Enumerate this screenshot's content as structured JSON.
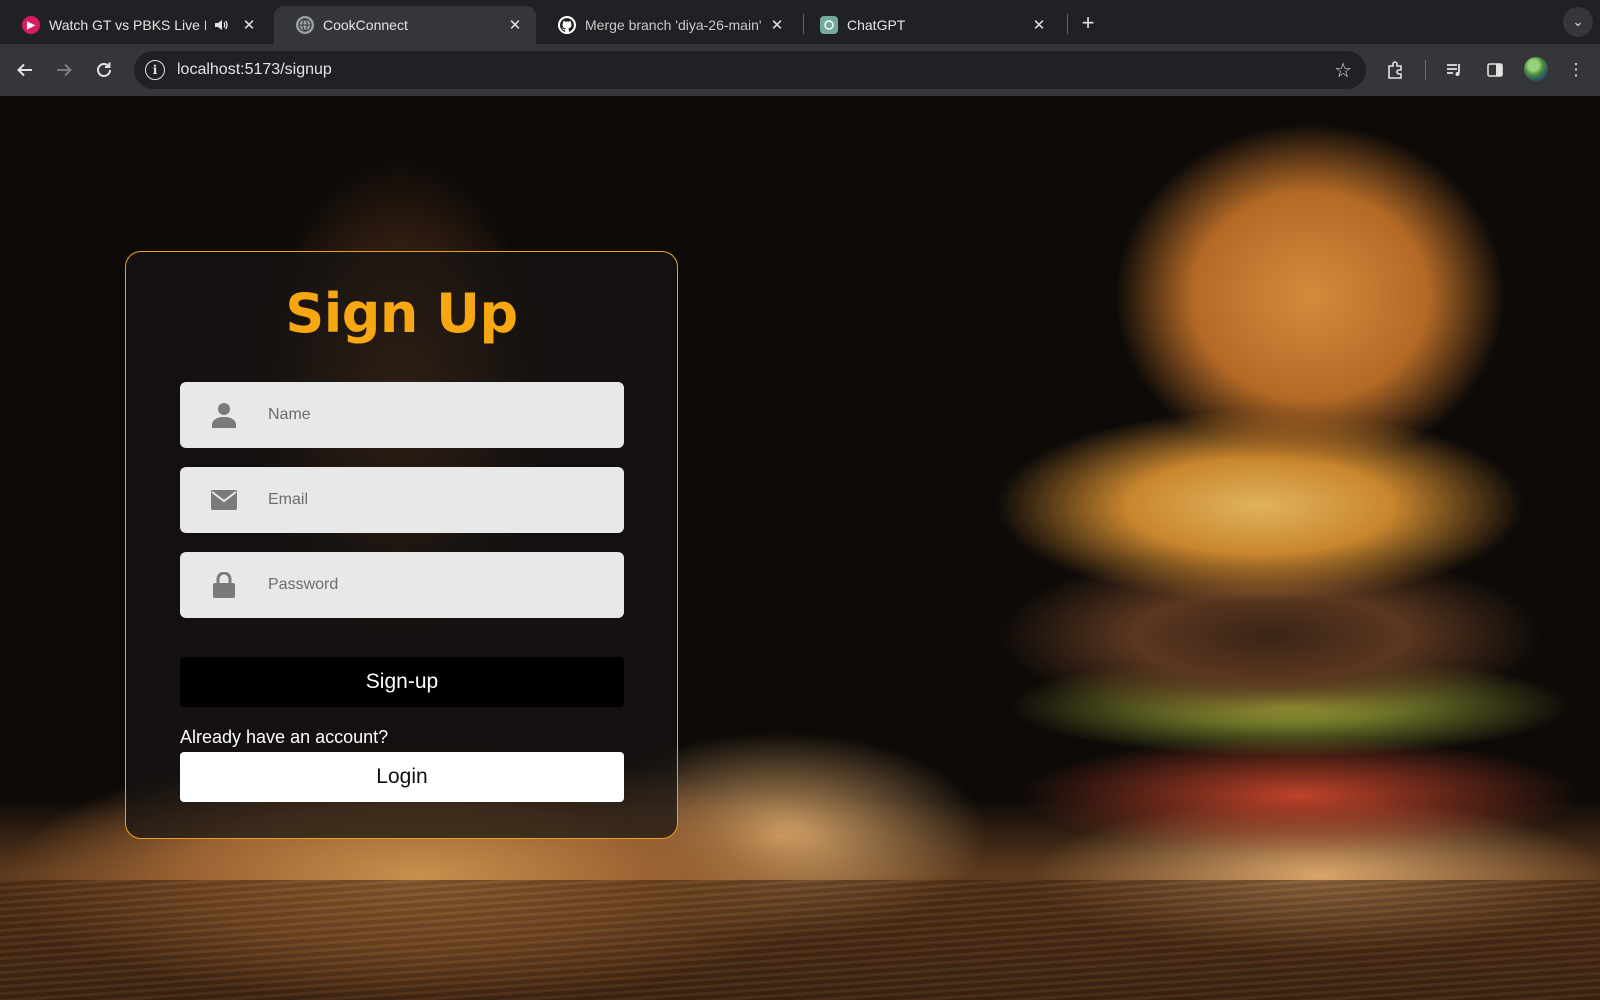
{
  "browser": {
    "tabs": [
      {
        "title": "Watch GT vs PBKS Live M",
        "favicon": "hotstar-icon",
        "favicon_color": "#d81b60",
        "audio": true
      },
      {
        "title": "CookConnect",
        "favicon": "globe-icon",
        "active": true
      },
      {
        "title": "Merge branch 'diya-26-main'",
        "favicon": "github-icon"
      },
      {
        "title": "ChatGPT",
        "favicon": "chatgpt-icon",
        "favicon_color": "#74aa9c"
      }
    ],
    "address_bar": {
      "url": "localhost:5173/signup"
    }
  },
  "signup": {
    "title": "Sign Up",
    "name_placeholder": "Name",
    "email_placeholder": "Email",
    "password_placeholder": "Password",
    "submit_label": "Sign-up",
    "already_text": "Already have an account?",
    "login_label": "Login"
  },
  "colors": {
    "accent": "#f7a712",
    "card_border": "#e8a21d",
    "input_bg": "#e8e8e8",
    "submit_bg": "#000000",
    "login_bg": "#ffffff"
  }
}
